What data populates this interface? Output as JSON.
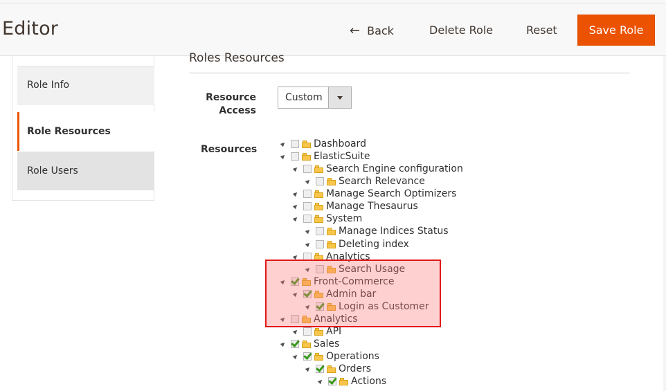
{
  "header": {
    "title": "Editor",
    "back_label": "Back",
    "delete_label": "Delete Role",
    "reset_label": "Reset",
    "save_label": "Save Role"
  },
  "sidebar": {
    "items": [
      {
        "label": "Role Info"
      },
      {
        "label": "Role Resources"
      },
      {
        "label": "Role Users"
      }
    ]
  },
  "main": {
    "section_title": "Roles Resources",
    "resource_access_label": "Resource Access",
    "resource_access_value": "Custom",
    "resources_label": "Resources"
  },
  "tree": [
    {
      "label": "Dashboard",
      "checked": false
    },
    {
      "label": "ElasticSuite",
      "checked": false
    },
    {
      "label": "Search Engine configuration",
      "checked": false
    },
    {
      "label": "Search Relevance",
      "checked": false
    },
    {
      "label": "Manage Search Optimizers",
      "checked": false
    },
    {
      "label": "Manage Thesaurus",
      "checked": false
    },
    {
      "label": "System",
      "checked": false
    },
    {
      "label": "Manage Indices Status",
      "checked": false
    },
    {
      "label": "Deleting index",
      "checked": false
    },
    {
      "label": "Analytics",
      "checked": false
    },
    {
      "label": "Search Usage",
      "checked": false
    },
    {
      "label": "Front-Commerce",
      "checked": true
    },
    {
      "label": "Admin bar",
      "checked": true
    },
    {
      "label": "Login as Customer",
      "checked": true
    },
    {
      "label": "Analytics",
      "checked": false
    },
    {
      "label": "API",
      "checked": false
    },
    {
      "label": "Sales",
      "checked": true
    },
    {
      "label": "Operations",
      "checked": true
    },
    {
      "label": "Orders",
      "checked": true
    },
    {
      "label": "Actions",
      "checked": true
    }
  ],
  "colors": {
    "accent": "#eb5202",
    "highlight_border": "#e01818"
  }
}
